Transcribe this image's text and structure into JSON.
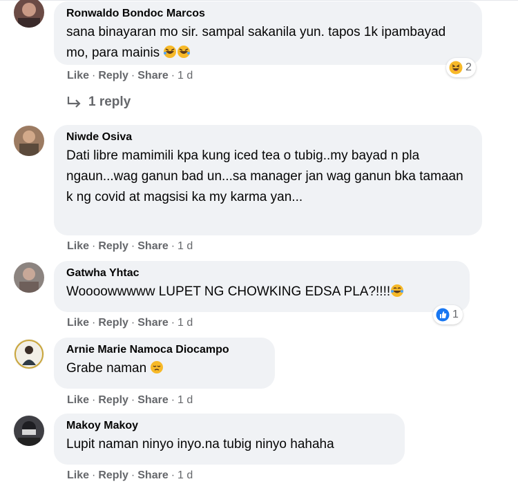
{
  "actions": {
    "like": "Like",
    "reply": "Reply",
    "share": "Share",
    "dot": "·"
  },
  "colors": {
    "bubble": "#f0f2f5",
    "meta": "#65676b",
    "text": "#050505",
    "like_blue": "#1877f2",
    "haha_yellow": "#f7b928"
  },
  "comments": [
    {
      "author": "Ronwaldo Bondoc Marcos",
      "text": "sana binayaran mo sir. sampal sakanila yun. tapos 1k ipambayad mo, para mainis",
      "emojis": [
        "rolling-on-floor-laughing-emoji",
        "rolling-on-floor-laughing-emoji"
      ],
      "time": "1 d",
      "reaction": {
        "icon": "haha-reaction-icon",
        "count": "2"
      },
      "replies_label": "1 reply"
    },
    {
      "author": "Niwde Osiva",
      "text": "Dati libre mamimili kpa kung iced tea o tubig..my bayad n pla ngaun...wag ganun bad un...sa manager jan wag ganun bka tamaan k ng covid at magsisi ka my karma yan...",
      "time": "1 d"
    },
    {
      "author": "Gatwha Yhtac",
      "text": "Woooowwwww LUPET NG CHOWKING EDSA PLA?!!!!",
      "emojis": [
        "tears-of-joy-emoji"
      ],
      "time": "1 d",
      "reaction": {
        "icon": "like-reaction-icon",
        "count": "1"
      }
    },
    {
      "author": "Arnie Marie Namoca Diocampo",
      "text": "Grabe naman",
      "emojis": [
        "pensive-face-emoji"
      ],
      "time": "1 d"
    },
    {
      "author": "Makoy Makoy",
      "text": "Lupit naman ninyo inyo.na tubig ninyo hahaha",
      "time": "1 d"
    }
  ]
}
